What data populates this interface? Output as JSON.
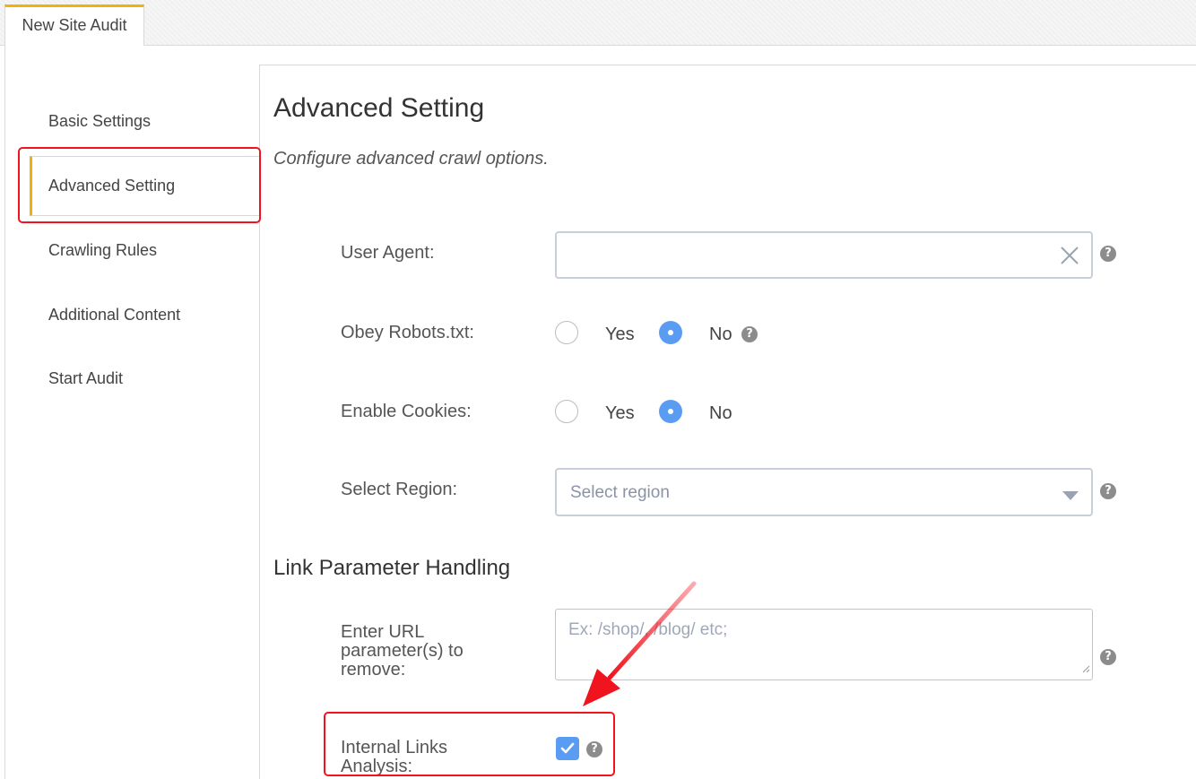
{
  "tab": {
    "label": "New Site Audit"
  },
  "sidebar": {
    "items": [
      {
        "label": "Basic Settings"
      },
      {
        "label": "Advanced Setting"
      },
      {
        "label": "Crawling Rules"
      },
      {
        "label": "Additional Content"
      },
      {
        "label": "Start Audit"
      }
    ],
    "active_index": 1
  },
  "main": {
    "title": "Advanced Setting",
    "subtitle": "Configure advanced crawl options.",
    "user_agent": {
      "label": "User Agent:",
      "value": ""
    },
    "obey_robots": {
      "label": "Obey Robots.txt:",
      "yes": "Yes",
      "no": "No",
      "selected": "No"
    },
    "enable_cookies": {
      "label": "Enable Cookies:",
      "yes": "Yes",
      "no": "No",
      "selected": "No"
    },
    "region": {
      "label": "Select Region:",
      "placeholder": "Select region"
    },
    "link_section_title": "Link Parameter Handling",
    "url_params": {
      "label": "Enter URL parameter(s) to remove:",
      "placeholder": "Ex: /shop/, /blog/ etc;"
    },
    "internal_links": {
      "label": "Internal Links Analysis:",
      "checked": true
    }
  },
  "colors": {
    "accent": "#f0b400",
    "highlight": "#f0141e",
    "primary": "#5b9cf3"
  },
  "icons": {
    "clear": "close-icon",
    "help": "question-circle-icon",
    "dropdown": "caret-down-icon",
    "check": "check-icon"
  }
}
